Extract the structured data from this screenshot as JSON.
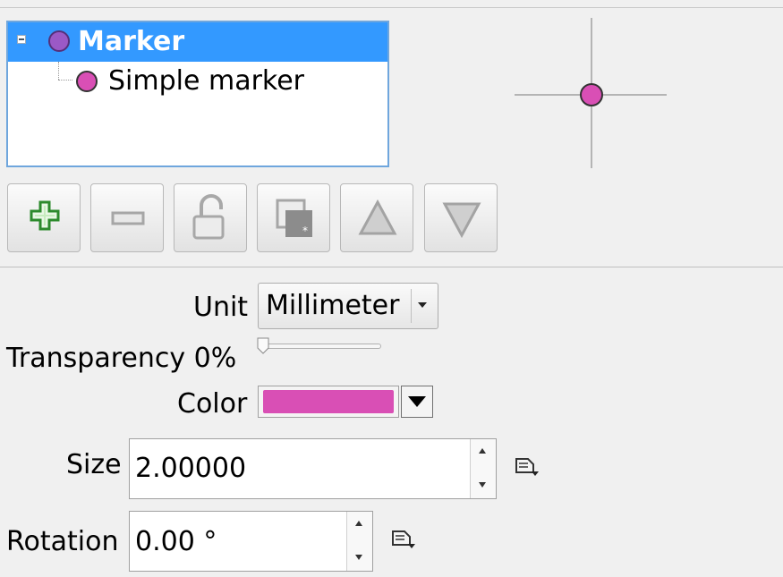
{
  "tree": {
    "root_label": "Marker",
    "child_label": "Simple marker",
    "root_icon": "purple-circle-icon",
    "child_icon": "magenta-circle-icon",
    "root_color": "#9b59c6",
    "child_color": "#d94fb5",
    "selection_color": "#3399ff"
  },
  "preview": {
    "icon": "crosshair-marker-preview"
  },
  "toolbar": {
    "buttons": [
      {
        "name": "add-layer-button",
        "icon": "plus-icon"
      },
      {
        "name": "remove-layer-button",
        "icon": "minus-icon"
      },
      {
        "name": "lock-layer-button",
        "icon": "unlock-icon"
      },
      {
        "name": "duplicate-layer-button",
        "icon": "duplicate-icon"
      },
      {
        "name": "move-up-button",
        "icon": "triangle-up-icon"
      },
      {
        "name": "move-down-button",
        "icon": "triangle-down-icon"
      }
    ]
  },
  "properties": {
    "unit_label": "Unit",
    "unit_value": "Millimeter",
    "transparency_label": "Transparency 0%",
    "transparency_value": 0,
    "color_label": "Color",
    "color_value": "#d94fb5",
    "size_label": "Size",
    "size_value": "2.00000",
    "rotation_label": "Rotation",
    "rotation_value": "0.00 °",
    "data_defined_icon": "data-defined-override-icon"
  }
}
